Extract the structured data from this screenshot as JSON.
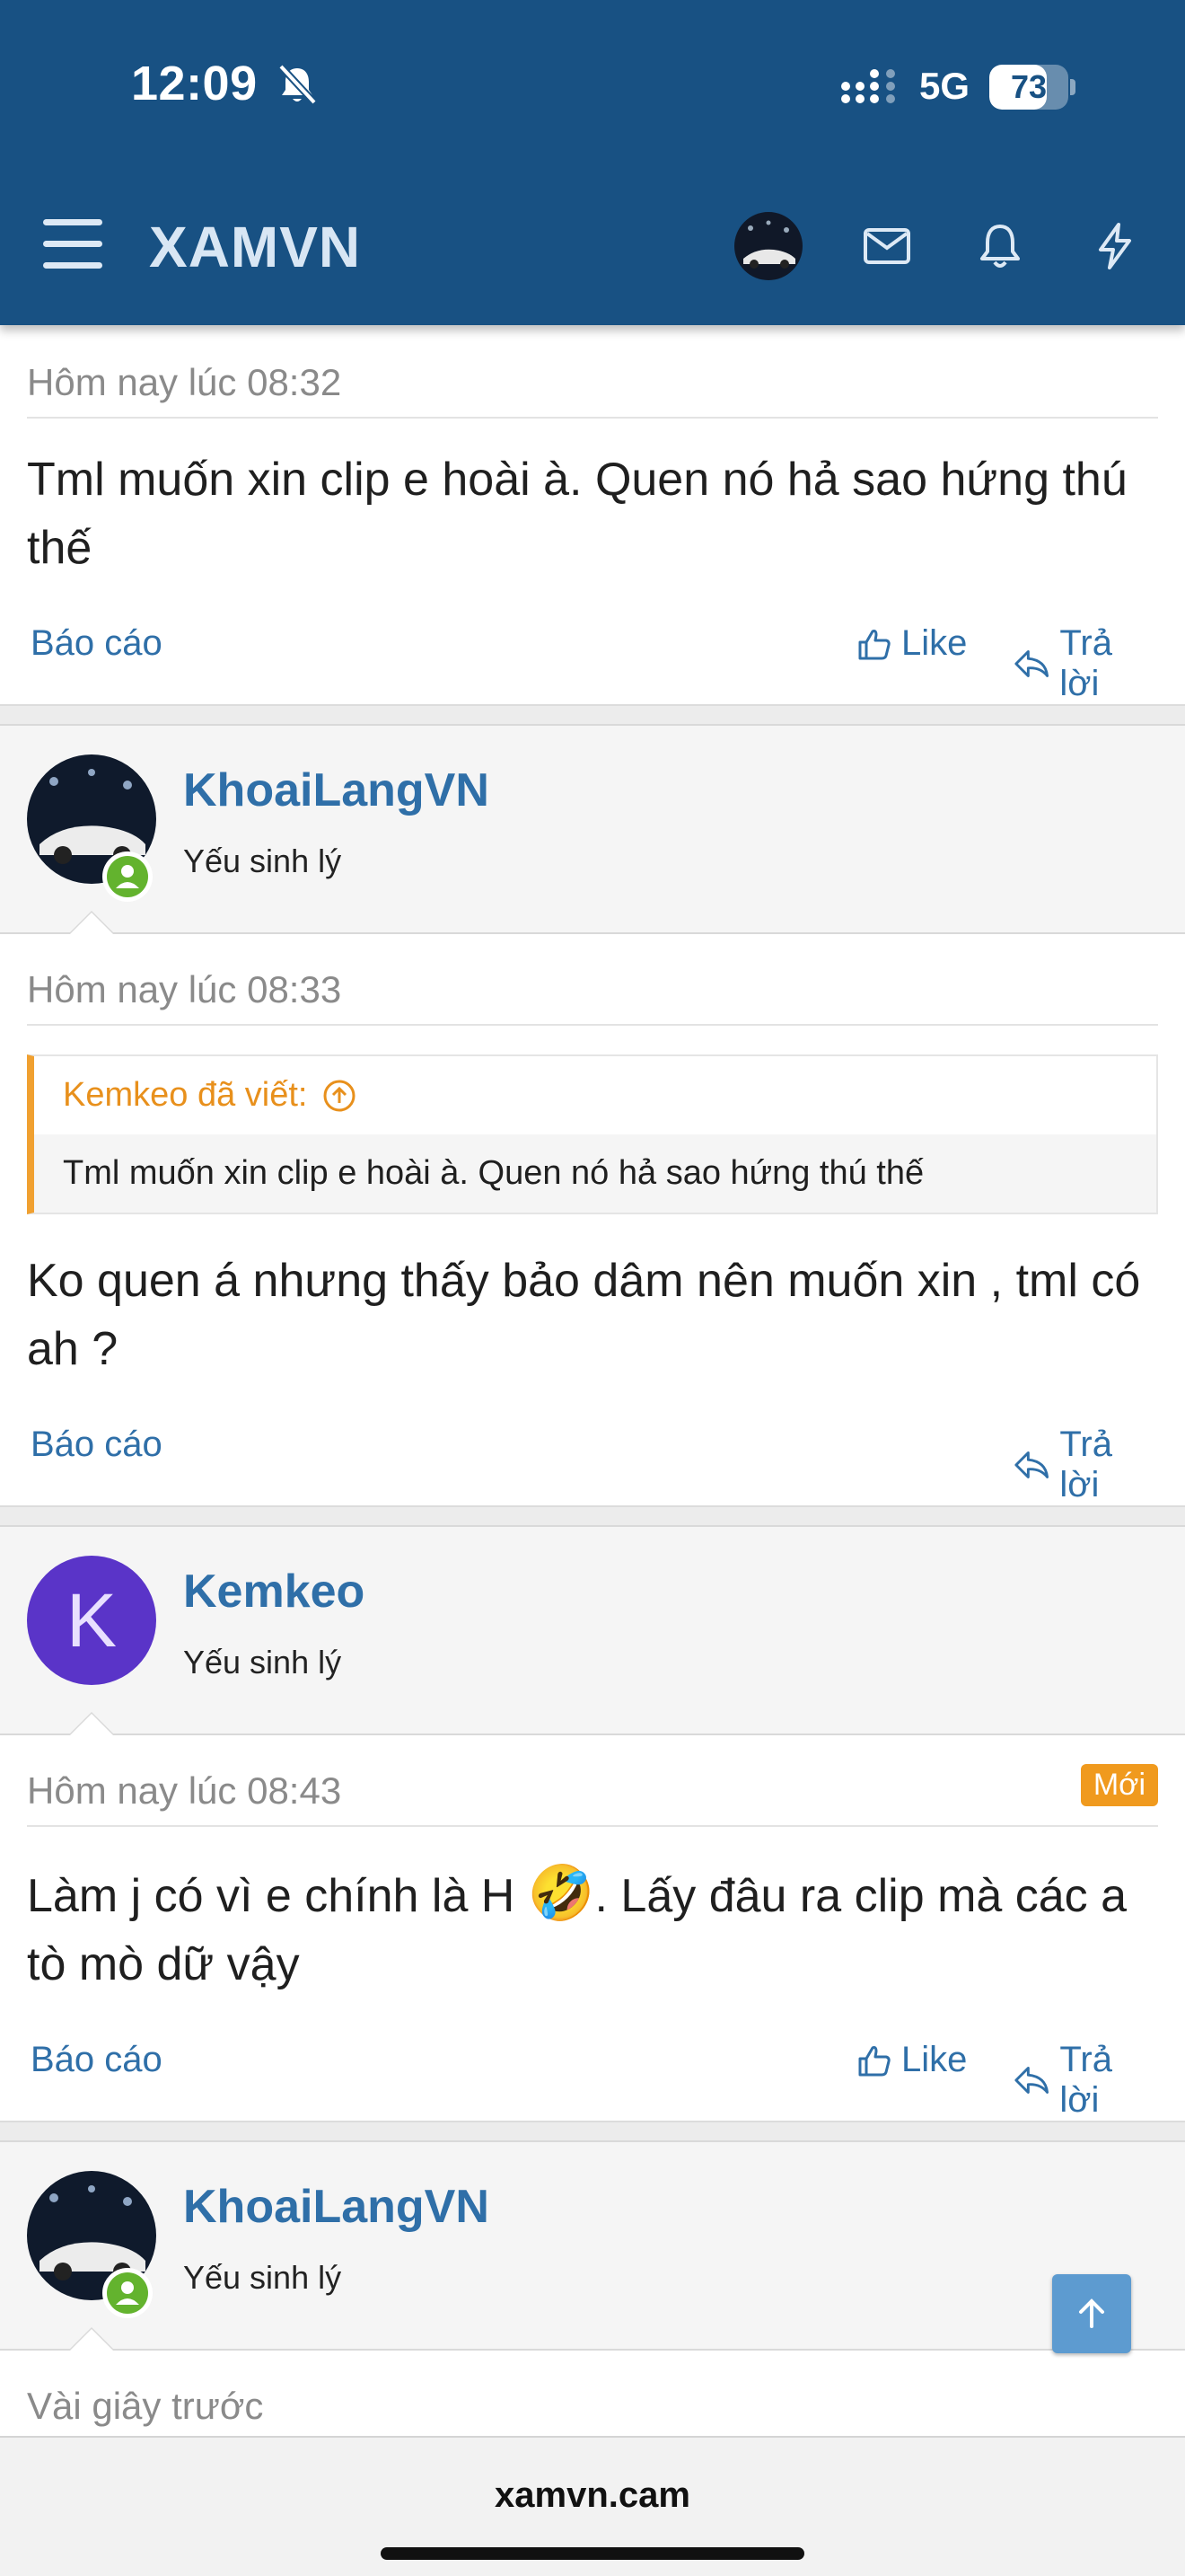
{
  "status": {
    "time": "12:09",
    "network": "5G",
    "battery": "73",
    "battery_level": 0.73
  },
  "header": {
    "brand": "XAMVN",
    "icons": [
      "menu-icon",
      "avatar",
      "mail-icon",
      "bell-icon",
      "lightning-icon"
    ]
  },
  "colors": {
    "header_bg": "#185183",
    "link": "#2f6fa8",
    "quote_accent": "#f0a030",
    "new_badge": "#f09a1e",
    "online": "#63b32e"
  },
  "posts": [
    {
      "time": "Hôm nay lúc 08:32",
      "text": "Tml muốn xin clip e hoài à. Quen nó hả sao hứng thú thế",
      "report": "Báo cáo",
      "like": "Like",
      "reply": "Trả lời"
    },
    {
      "user": {
        "name": "KhoaiLangVN",
        "title": "Yếu sinh lý"
      },
      "time": "Hôm nay lúc 08:33",
      "quote": {
        "author": "Kemkeo đã viết:",
        "text": "Tml muốn xin clip e hoài à. Quen nó hả sao hứng thú thế"
      },
      "text": "Ko quen á nhưng thấy bảo dâm nên muốn xin , tml có ah ?",
      "report": "Báo cáo",
      "reply": "Trả lời"
    },
    {
      "user": {
        "name": "Kemkeo",
        "title": "Yếu sinh lý",
        "initial": "K"
      },
      "time": "Hôm nay lúc 08:43",
      "badge": "Mới",
      "text_before": "Làm j có vì e chính là H ",
      "emoji": "🤣",
      "text_after": ". Lấy đâu ra clip mà các a tò mò dữ vậy",
      "report": "Báo cáo",
      "like": "Like",
      "reply": "Trả lời"
    },
    {
      "user": {
        "name": "KhoaiLangVN",
        "title": "Yếu sinh lý"
      },
      "time": "Vài giây trước"
    }
  ],
  "browser": {
    "url": "xamvn.cam"
  }
}
